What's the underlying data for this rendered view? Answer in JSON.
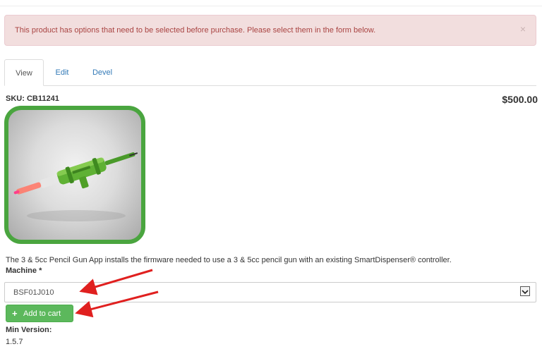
{
  "alert": {
    "message": "This product has options that need to be selected before purchase. Please select them in the form below.",
    "close_glyph": "×"
  },
  "tabs": [
    {
      "label": "View",
      "active": true
    },
    {
      "label": "Edit",
      "active": false
    },
    {
      "label": "Devel",
      "active": false
    }
  ],
  "product": {
    "sku": "SKU: CB11241",
    "price": "$500.00",
    "description": "The 3 & 5cc Pencil Gun App installs the firmware needed to use a 3 & 5cc pencil gun with an existing SmartDispenser® controller.",
    "image_icon": "pencil-gun-image"
  },
  "form": {
    "machine_label": "Machine *",
    "machine_value": "BSF01J010",
    "add_to_cart_label": "Add to cart",
    "add_icon": "plus-icon"
  },
  "details": {
    "min_version_label": "Min Version:",
    "min_version_value": "1.5.7"
  },
  "colors": {
    "alert_bg": "#f2dede",
    "alert_text": "#a94442",
    "link": "#337ab7",
    "button_green": "#5cb85c",
    "image_border": "#4aa53f",
    "annotation_arrow": "#e0201f"
  }
}
